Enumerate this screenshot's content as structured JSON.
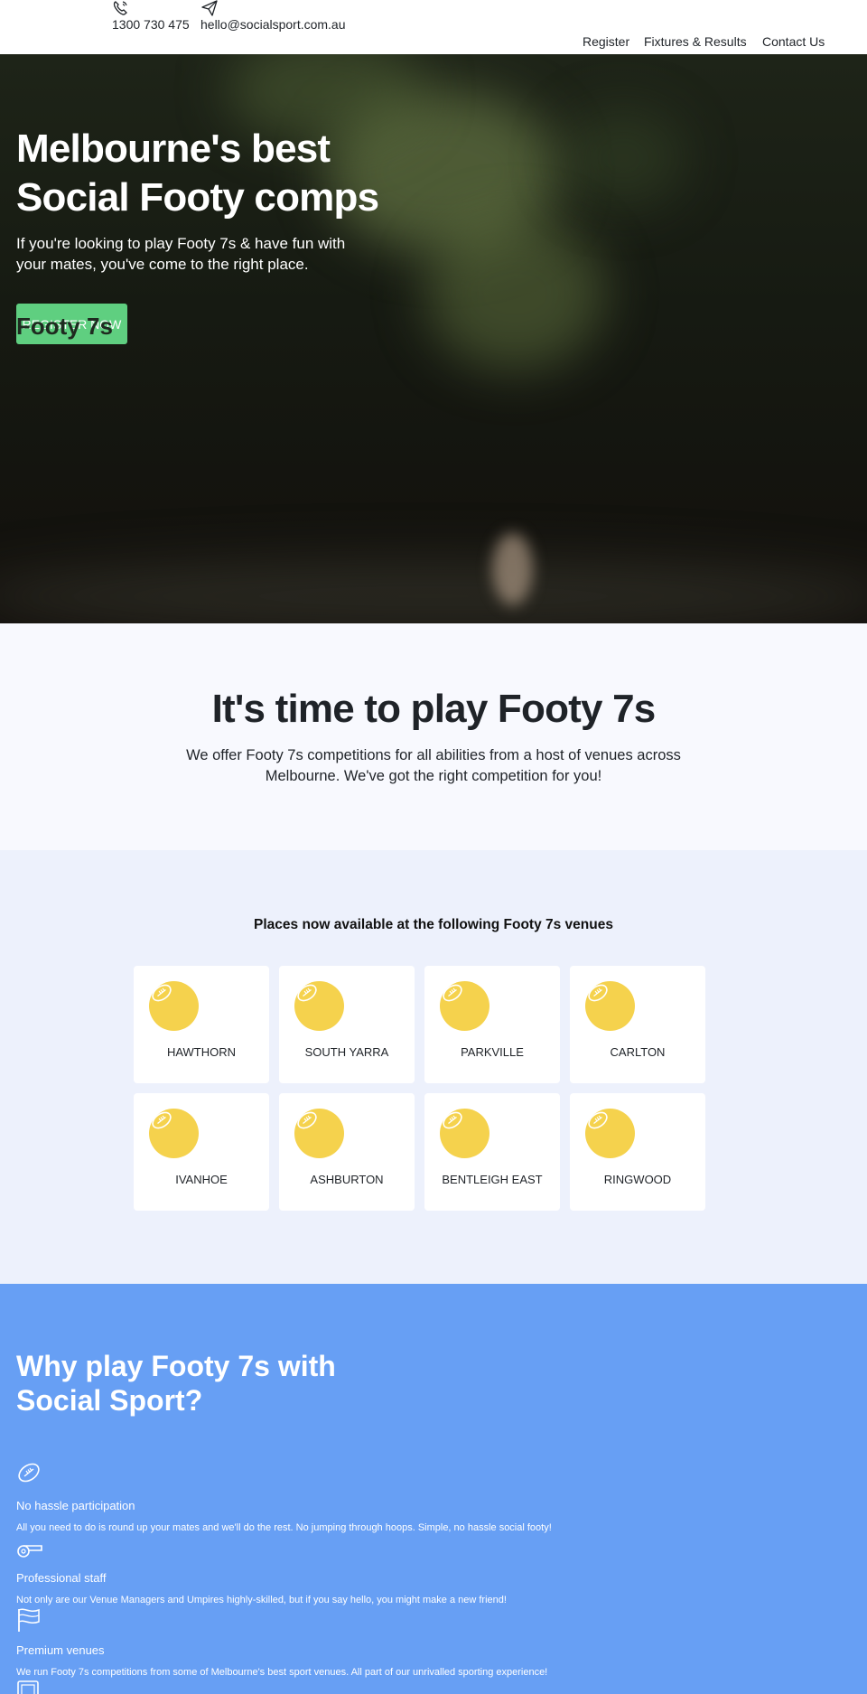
{
  "header": {
    "phone": {
      "icon": "phone-icon",
      "value": "1300 730 475"
    },
    "email": {
      "icon": "send-icon",
      "value": "hello@socialsport.com.au"
    },
    "nav": [
      "Register",
      "Fixtures & Results",
      "Contact Us"
    ]
  },
  "hero": {
    "title": "Melbourne's best Social Footy comps",
    "subtitle": "If you're looking to play Footy 7s & have fun with your mates, you've come to the right place.",
    "button_label": "REGISTER NOW",
    "overlap_text": "Footy 7s"
  },
  "intro": {
    "heading": "It's time to play Footy 7s",
    "text": "We offer Footy 7s competitions for all abilities from a host of venues across Melbourne. We've got the right competition for you!"
  },
  "venues": {
    "heading": "Places now available at the following Footy 7s venues",
    "icon": "football-icon",
    "items": [
      "HAWTHORN",
      "SOUTH YARRA",
      "PARKVILLE",
      "CARLTON",
      "IVANHOE",
      "ASHBURTON",
      "BENTLEIGH EAST",
      "RINGWOOD"
    ]
  },
  "why": {
    "heading": "Why play Footy 7s with Social Sport?",
    "features": [
      {
        "icon": "football-icon",
        "title": "No hassle participation",
        "desc": "All you need to do is round up your mates and we'll do the rest. No jumping through hoops. Simple, no hassle social footy!"
      },
      {
        "icon": "whistle-icon",
        "title": "Professional staff",
        "desc": "Not only are our Venue Managers and Umpires highly-skilled, but if you say hello, you might make a new friend!"
      },
      {
        "icon": "flag-icon",
        "title": "Premium venues",
        "desc": "We run Footy 7s competitions from some of Melbourne's best sport venues. All part of our unrivalled sporting experience!"
      }
    ]
  },
  "colors": {
    "accent_green": "#5fcf80",
    "ball_yellow": "#f5d24d",
    "why_blue": "#679ff4",
    "venues_bg": "#edf1fc"
  }
}
